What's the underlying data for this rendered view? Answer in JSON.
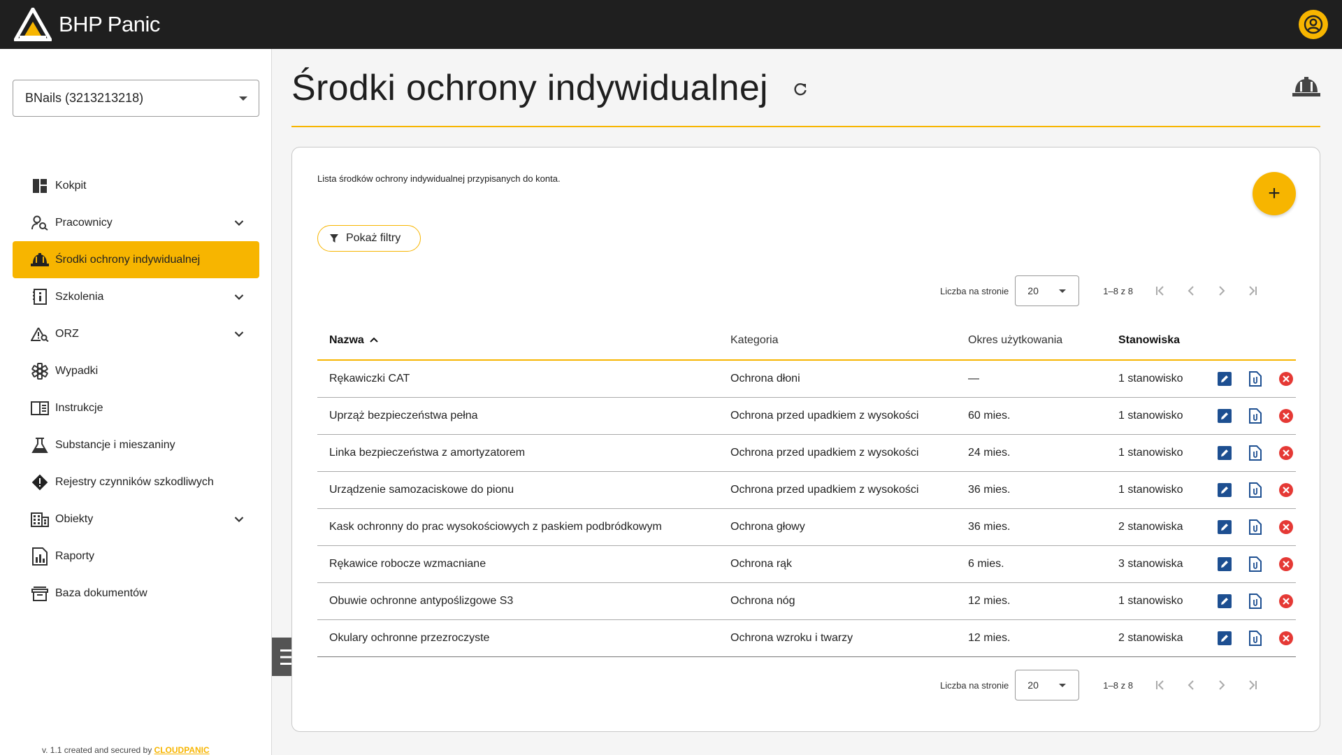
{
  "app": {
    "name": "BHP Panic",
    "colors": {
      "accent": "#f7b500",
      "topbar": "#1f1f1f",
      "edit": "#1d4f91",
      "delete": "#e53935"
    }
  },
  "sidebar": {
    "company": "BNails (3213213218)",
    "items": [
      {
        "label": "Kokpit",
        "icon": "dashboard-icon",
        "expandable": false,
        "active": false
      },
      {
        "label": "Pracownicy",
        "icon": "person-search-icon",
        "expandable": true,
        "active": false
      },
      {
        "label": "Środki ochrony indywidualnej",
        "icon": "hard-hat-icon",
        "expandable": false,
        "active": true
      },
      {
        "label": "Szkolenia",
        "icon": "training-book-icon",
        "expandable": true,
        "active": false
      },
      {
        "label": "ORZ",
        "icon": "risk-warning-icon",
        "expandable": true,
        "active": false
      },
      {
        "label": "Wypadki",
        "icon": "medical-star-icon",
        "expandable": false,
        "active": false
      },
      {
        "label": "Instrukcje",
        "icon": "book-icon",
        "expandable": false,
        "active": false
      },
      {
        "label": "Substancje i mieszaniny",
        "icon": "flask-icon",
        "expandable": false,
        "active": false
      },
      {
        "label": "Rejestry czynników szkodliwych",
        "icon": "hazard-diamond-icon",
        "expandable": false,
        "active": false
      },
      {
        "label": "Obiekty",
        "icon": "building-icon",
        "expandable": true,
        "active": false
      },
      {
        "label": "Raporty",
        "icon": "report-icon",
        "expandable": false,
        "active": false
      },
      {
        "label": "Baza dokumentów",
        "icon": "archive-icon",
        "expandable": false,
        "active": false
      }
    ],
    "footer_prefix": "v. 1.1 created and secured by ",
    "footer_brand": "CLOUDPANIC"
  },
  "main": {
    "title": "Środki ochrony indywidualnej",
    "description": "Lista środków ochrony indywidualnej przypisanych do konta.",
    "filter_label": "Pokaż filtry",
    "add_label": "+",
    "pager": {
      "per_page_label": "Liczba na stronie",
      "per_page": "20",
      "range": "1–8 z 8"
    },
    "columns": [
      "Nazwa",
      "Kategoria",
      "Okres użytkowania",
      "Stanowiska"
    ],
    "rows": [
      {
        "name": "Rękawiczki CAT",
        "category": "Ochrona dłoni",
        "period": "—",
        "positions": "1 stanowisko"
      },
      {
        "name": "Uprząż bezpieczeństwa pełna",
        "category": "Ochrona przed upadkiem z wysokości",
        "period": "60 mies.",
        "positions": "1 stanowisko"
      },
      {
        "name": "Linka bezpieczeństwa z amortyzatorem",
        "category": "Ochrona przed upadkiem z wysokości",
        "period": "24 mies.",
        "positions": "1 stanowisko"
      },
      {
        "name": "Urządzenie samozaciskowe do pionu",
        "category": "Ochrona przed upadkiem z wysokości",
        "period": "36 mies.",
        "positions": "1 stanowisko"
      },
      {
        "name": "Kask ochronny do prac wysokościowych z paskiem podbródkowym",
        "category": "Ochrona głowy",
        "period": "36 mies.",
        "positions": "2 stanowiska"
      },
      {
        "name": "Rękawice robocze wzmacniane",
        "category": "Ochrona rąk",
        "period": "6 mies.",
        "positions": "3 stanowiska"
      },
      {
        "name": "Obuwie ochronne antypoślizgowe S3",
        "category": "Ochrona nóg",
        "period": "12 mies.",
        "positions": "1 stanowisko"
      },
      {
        "name": "Okulary ochronne przezroczyste",
        "category": "Ochrona wzroku i twarzy",
        "period": "12 mies.",
        "positions": "2 stanowiska"
      }
    ]
  }
}
